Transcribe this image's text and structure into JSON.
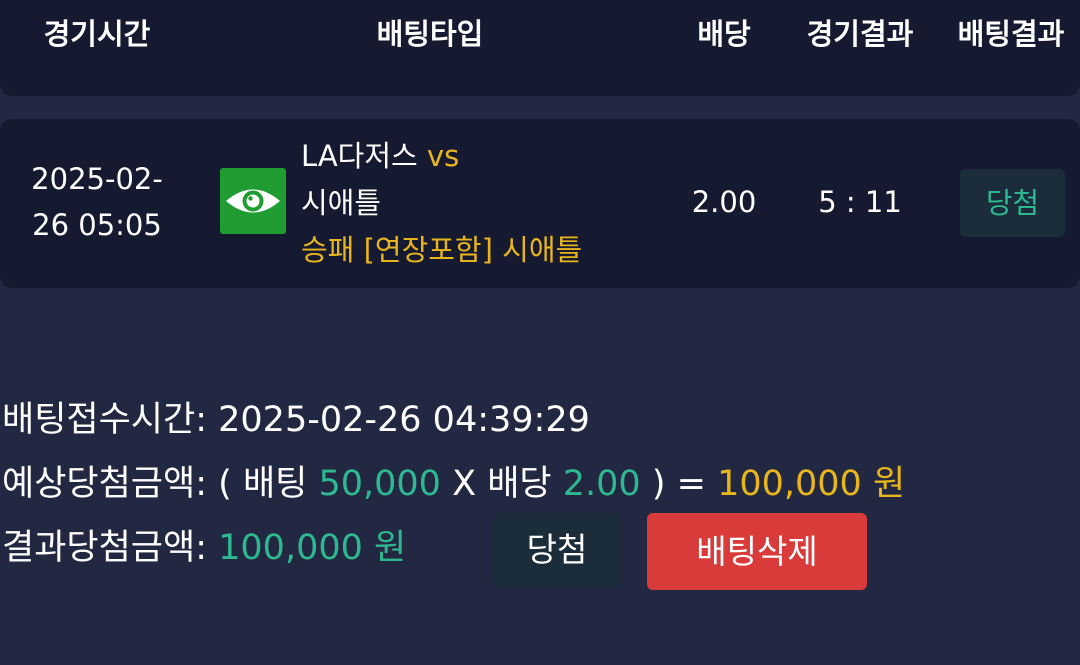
{
  "header": {
    "col_time": "경기시간",
    "col_type": "배팅타입",
    "col_odds": "배당",
    "col_game_result": "경기결과",
    "col_bet_result": "배팅결과"
  },
  "bet_row": {
    "time_line1": "2025-02-",
    "time_line2": "26 05:05",
    "home_team": "LA다저스",
    "vs": "vs",
    "away_team": "시애틀",
    "pick": "승패 [연장포함] 시애틀",
    "odds": "2.00",
    "score": "5 : 11",
    "result": "당첨",
    "icon": "eye-icon"
  },
  "summary": {
    "accept_label": "배팅접수시간:",
    "accept_time": "2025-02-26 04:39:29",
    "expected_label": "예상당첨금액:",
    "open_paren": "(",
    "bet_label": "배팅",
    "bet_amount": "50,000",
    "times": "X",
    "odds_label": "배당",
    "odds_value": "2.00",
    "close_eq": ") =",
    "expected_amount": "100,000 원",
    "result_label": "결과당첨금액:",
    "result_amount": "100,000 원"
  },
  "buttons": {
    "win_label": "당첨",
    "delete_label": "배팅삭제"
  },
  "colors": {
    "background": "#222841",
    "card": "#161a30",
    "accent_green": "#2eb890",
    "accent_yellow": "#e9b51c",
    "delete_red": "#d93b3b",
    "icon_green": "#1f9d33"
  }
}
